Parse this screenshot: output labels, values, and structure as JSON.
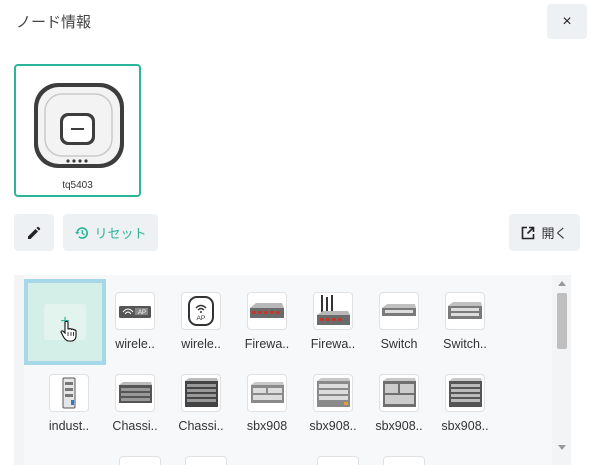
{
  "header": {
    "title": "ノード情報",
    "close_icon": "×"
  },
  "node": {
    "name": "tq5403",
    "icon": "access-point-icon"
  },
  "toolbar": {
    "edit_icon": "pencil-icon",
    "reset_label": "リセット",
    "reset_icon": "history-icon",
    "open_label": "開く",
    "open_icon": "open-external-icon"
  },
  "palette": {
    "add_label": "+",
    "row1": [
      "wirele..",
      "wirele..",
      "Firewa..",
      "Firewa..",
      "Switch",
      "Switch.."
    ],
    "row2": [
      "indust..",
      "Chassi..",
      "Chassi..",
      "sbx908",
      "sbx908..",
      "sbx908..",
      "sbx908.."
    ]
  },
  "colors": {
    "accent": "#2bb59a",
    "selection_border": "#a6d8ea"
  }
}
